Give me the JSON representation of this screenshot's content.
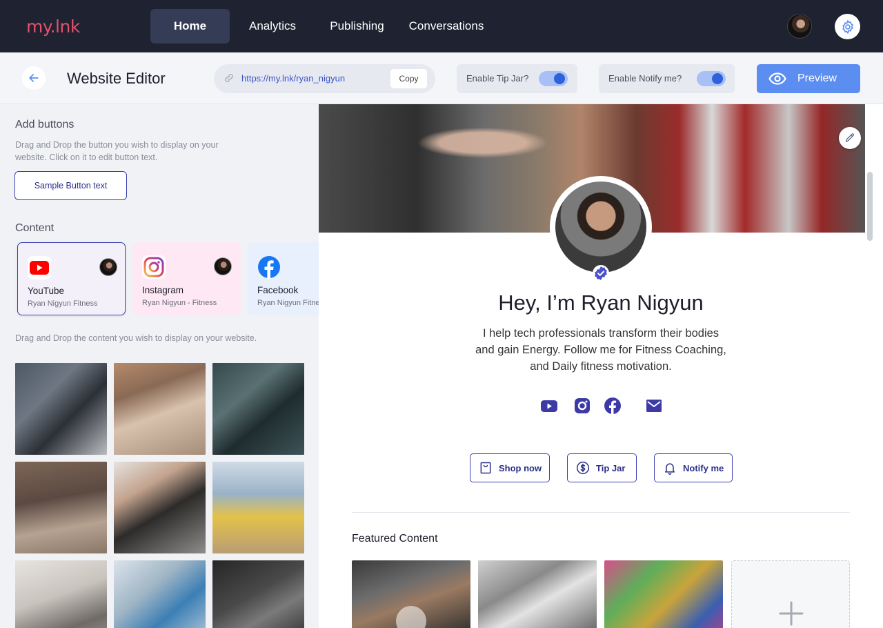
{
  "nav": {
    "brand": "my.lnk",
    "items": [
      {
        "label": "Home",
        "active": true
      },
      {
        "label": "Analytics",
        "active": false
      },
      {
        "label": "Publishing",
        "active": false
      },
      {
        "label": "Conversations",
        "active": false
      }
    ],
    "icons": {
      "settings": "gear-icon",
      "avatar": "user-avatar"
    }
  },
  "toolbar": {
    "title": "Website Editor",
    "url": "https://my.lnk/ryan_nigyun",
    "copy_label": "Copy",
    "tip_jar_label": "Enable Tip Jar?",
    "tip_jar_enabled": true,
    "notify_label": "Enable Notify me?",
    "notify_enabled": true,
    "preview_label": "Preview"
  },
  "left": {
    "add_buttons_title": "Add buttons",
    "add_buttons_desc": "Drag and Drop the button you wish to display on your website. Click on it to edit button text.",
    "sample_button": "Sample Button text",
    "content_title": "Content",
    "content_cards": [
      {
        "name": "YouTube",
        "sub": "Ryan Nigyun Fitness",
        "icon": "youtube-icon",
        "selected": true
      },
      {
        "name": "Instagram",
        "sub": "Ryan Nigyun - Fitness",
        "icon": "instagram-icon",
        "selected": false
      },
      {
        "name": "Facebook",
        "sub": "Ryan Nigyun Fitness",
        "icon": "facebook-icon",
        "selected": false
      }
    ],
    "content_desc": "Drag and Drop the content you wish to display on your website."
  },
  "preview": {
    "name": "Hey, I’m Ryan Nigyun",
    "bio": "I help tech professionals transform their bodies and gain Energy. Follow me for Fitness Coaching, and Daily fitness motivation.",
    "socials": [
      "youtube-icon",
      "instagram-icon",
      "facebook-icon",
      "mail-icon"
    ],
    "buttons": [
      {
        "label": "Shop now",
        "icon": "shopping-bag-icon"
      },
      {
        "label": "Tip Jar",
        "icon": "dollar-icon"
      },
      {
        "label": "Notify me",
        "icon": "bell-icon"
      }
    ],
    "featured_title": "Featured Content"
  },
  "colors": {
    "nav_bg": "#1e2231",
    "brand": "#e3516a",
    "accent": "#3b3fb0",
    "preview_btn": "#5b8ef0",
    "social": "#3d3aa8"
  }
}
